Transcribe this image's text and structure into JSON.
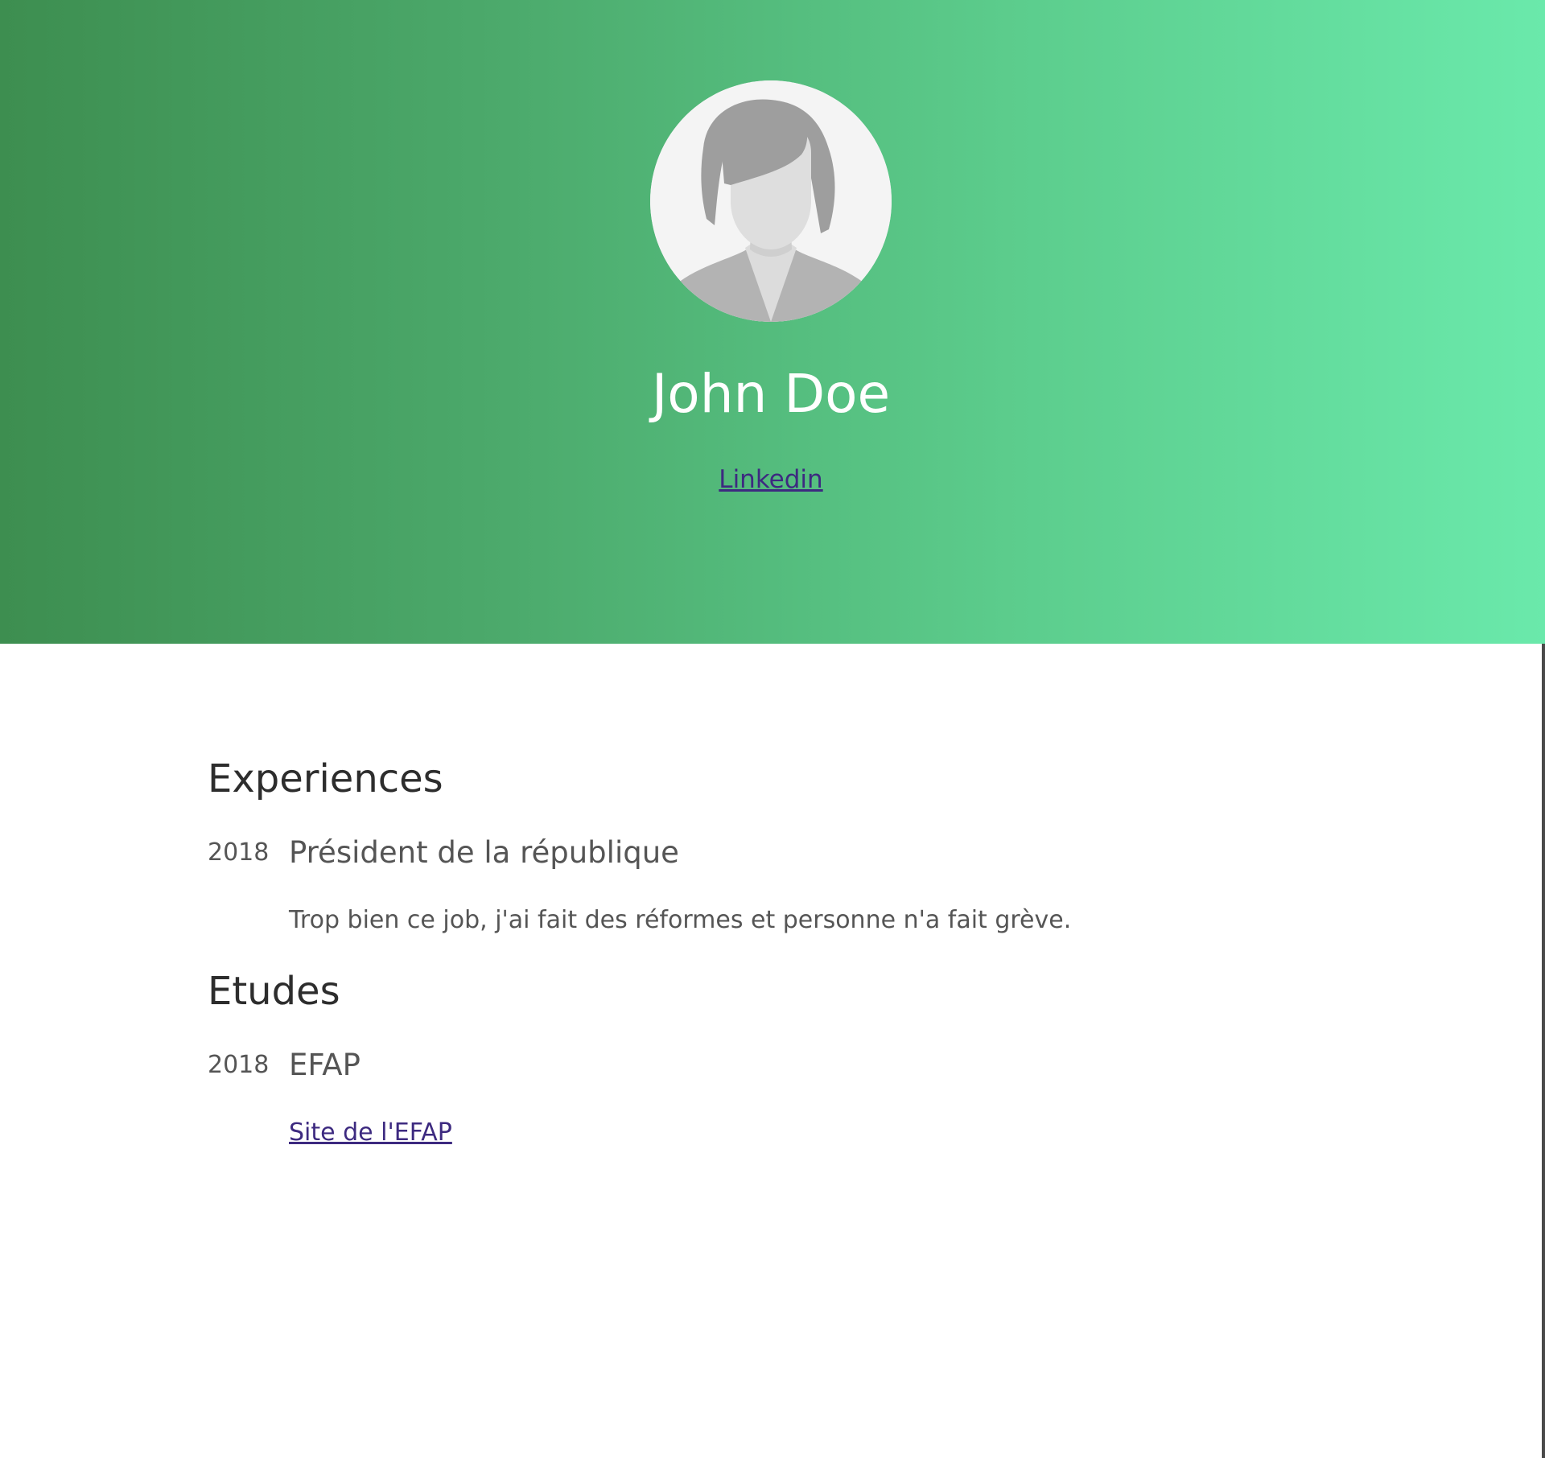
{
  "profile": {
    "name": "John Doe",
    "linkedin_label": "Linkedin",
    "avatar_icon": "female-avatar-placeholder-icon"
  },
  "theme": {
    "gradient_start": "#3d8e50",
    "gradient_end": "#6ae9ab",
    "link_color": "#3d2a80",
    "text_color": "#555555"
  },
  "experiences": {
    "title": "Experiences",
    "items": [
      {
        "year": "2018",
        "title": "Président de la république",
        "description": "Trop bien ce job, j'ai fait des réformes et personne n'a fait grève."
      }
    ]
  },
  "education": {
    "title": "Etudes",
    "items": [
      {
        "year": "2018",
        "title": "EFAP",
        "link_label": "Site de l'EFAP"
      }
    ]
  }
}
